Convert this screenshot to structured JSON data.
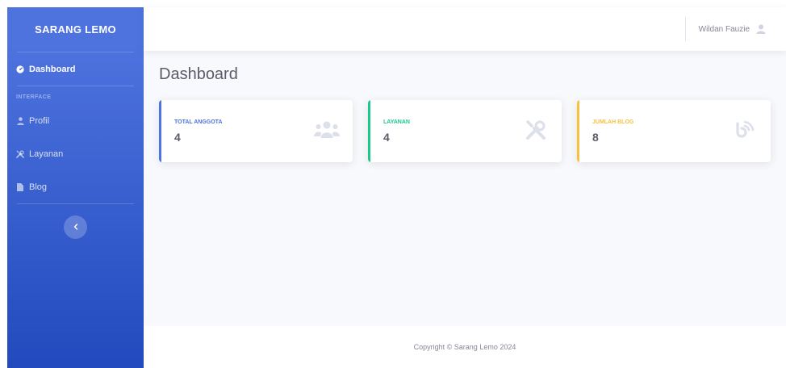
{
  "sidebar": {
    "brand": "SARANG LEMO",
    "dashboard_label": "Dashboard",
    "heading": "INTERFACE",
    "items": [
      {
        "label": "Profil",
        "icon": "user-icon"
      },
      {
        "label": "Layanan",
        "icon": "tools-icon"
      },
      {
        "label": "Blog",
        "icon": "file-icon"
      }
    ],
    "toggle_icon": "chevron-left-icon"
  },
  "topbar": {
    "user_name": "Wildan Fauzie",
    "avatar_icon": "user-icon"
  },
  "page": {
    "title": "Dashboard"
  },
  "cards": [
    {
      "label": "TOTAL ANGGOTA",
      "value": "4",
      "icon": "users-icon",
      "color": "#4e73df"
    },
    {
      "label": "LAYANAN",
      "value": "4",
      "icon": "tools-icon",
      "color": "#1cc88a"
    },
    {
      "label": "JUMLAH BLOG",
      "value": "8",
      "icon": "blog-icon",
      "color": "#f6c23e"
    }
  ],
  "footer": {
    "copyright": "Copyright © Sarang Lemo 2024"
  },
  "colors": {
    "sidebar_start": "#4e73df",
    "sidebar_end": "#224abe",
    "background": "#f8f9fc"
  }
}
